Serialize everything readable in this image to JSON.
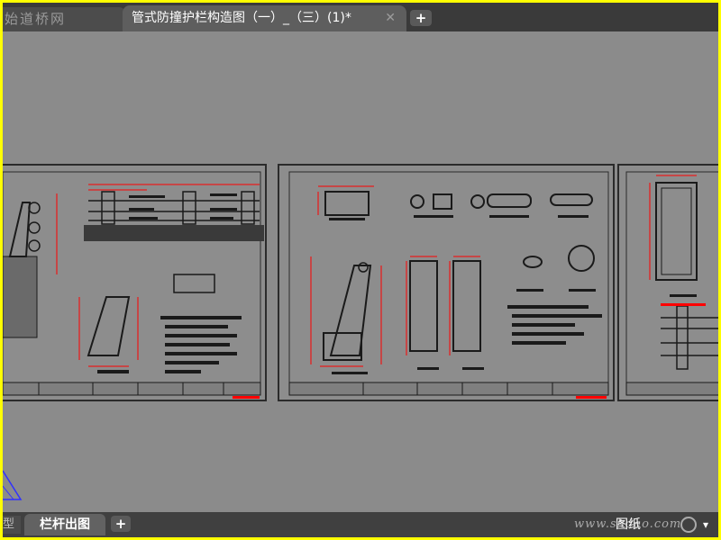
{
  "tabs": {
    "inactive_label": "始道桥网",
    "active_label": "管式防撞护栏构造图（一）_（三）(1)*",
    "close_glyph": "✕",
    "new_glyph": "+"
  },
  "bottom": {
    "prev_glyph": "型",
    "layout_label": "栏杆出图",
    "new_glyph": "+",
    "space_label": "图纸",
    "menu_glyph": "▾"
  },
  "watermark": "www.shdao.com",
  "colors": {
    "highlight_border": "#ffff00",
    "canvas_bg": "#8b8b8b",
    "dimension": "#ff0000",
    "linework": "#1a1a1a",
    "ucs": "#3030ff"
  },
  "icons": {
    "close": "close-icon",
    "add": "plus-icon",
    "zoom": "zoom-icon",
    "ucs": "ucs-icon"
  }
}
